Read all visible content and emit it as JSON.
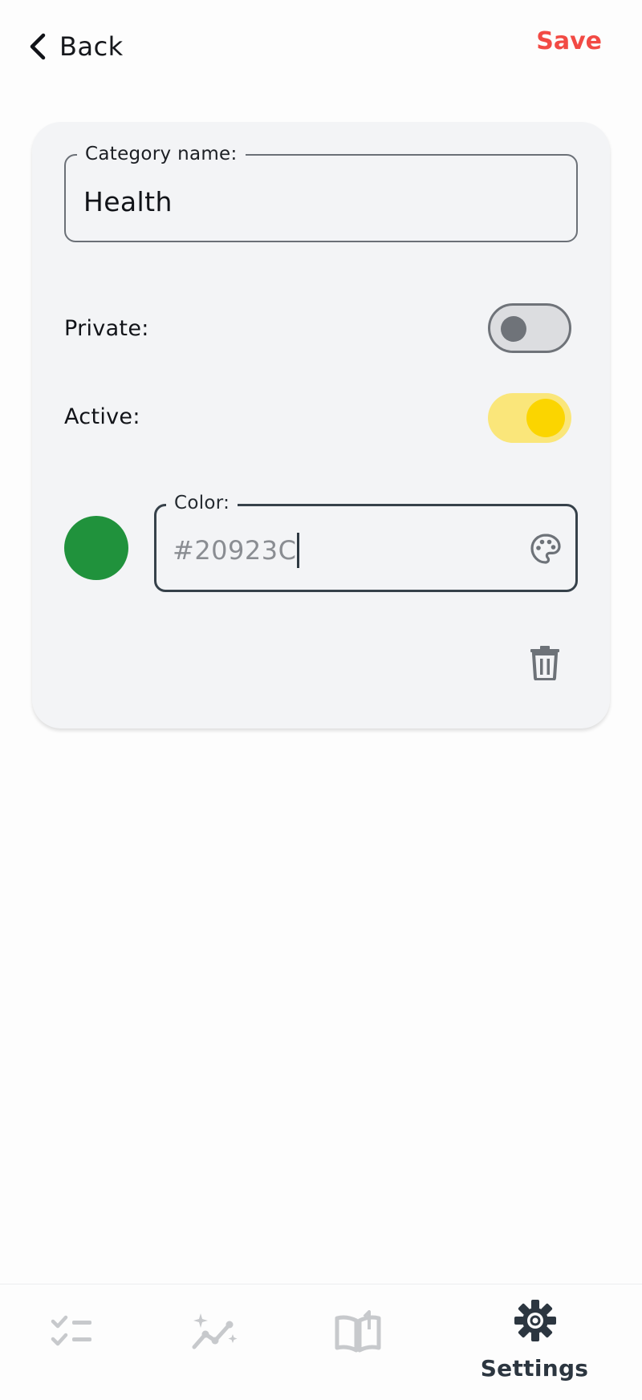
{
  "header": {
    "back_label": "Back",
    "save_label": "Save"
  },
  "form": {
    "name_legend": "Category name:",
    "name_value": "Health",
    "private_label": "Private:",
    "private_on": false,
    "active_label": "Active:",
    "active_on": true,
    "color_legend": "Color:",
    "color_value": "#20923C"
  },
  "colors": {
    "accent_save": "#f24a44",
    "toggle_on_track": "#fae67a",
    "toggle_on_knob": "#fbd500",
    "swatch": "#20923C",
    "nav_active": "#2c3640",
    "nav_inactive": "#c7c9cc"
  },
  "bottom_nav": {
    "items": [
      {
        "icon": "tasks-checklist-icon",
        "label": ""
      },
      {
        "icon": "stats-sparkle-chart-icon",
        "label": ""
      },
      {
        "icon": "journal-book-icon",
        "label": ""
      },
      {
        "icon": "settings-gear-icon",
        "label": "Settings"
      }
    ]
  }
}
